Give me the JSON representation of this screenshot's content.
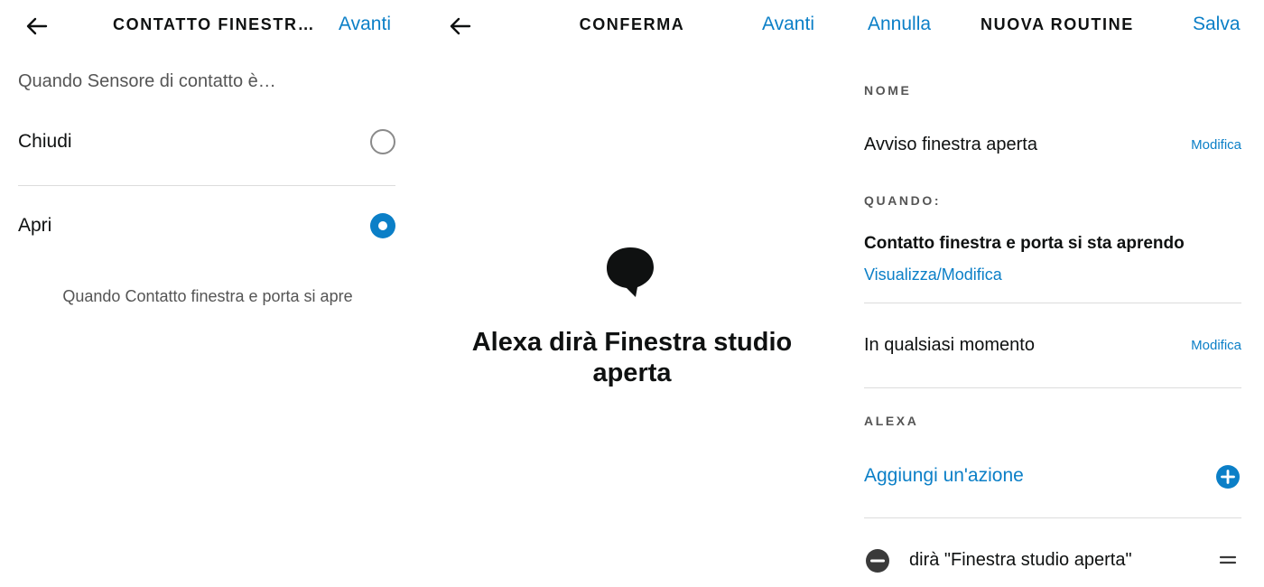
{
  "colors": {
    "accent": "#0b7fc7",
    "text": "#0f1111",
    "muted": "#555555",
    "divider": "#dcdcdc"
  },
  "panel1": {
    "title": "CONTATTO FINESTR…",
    "next_label": "Avanti",
    "lead": "Quando Sensore di contatto è…",
    "options": [
      {
        "label": "Chiudi",
        "selected": false
      },
      {
        "label": "Apri",
        "selected": true
      }
    ],
    "hint": "Quando Contatto finestra e porta si apre"
  },
  "panel2": {
    "title": "CONFERMA",
    "next_label": "Avanti",
    "icon": "speech-bubble-icon",
    "message": "Alexa dirà Finestra studio aperta"
  },
  "panel3": {
    "cancel_label": "Annulla",
    "title": "NUOVA ROUTINE",
    "save_label": "Salva",
    "name_header": "NOME",
    "name_value": "Avviso finestra aperta",
    "edit_label": "Modifica",
    "when_header": "QUANDO:",
    "trigger": "Contatto finestra e porta si sta aprendo",
    "view_edit_label": "Visualizza/Modifica",
    "schedule": "In qualsiasi momento",
    "alexa_header": "ALEXA",
    "add_action_label": "Aggiungi un'azione",
    "action": "dirà \"Finestra studio aperta\""
  }
}
